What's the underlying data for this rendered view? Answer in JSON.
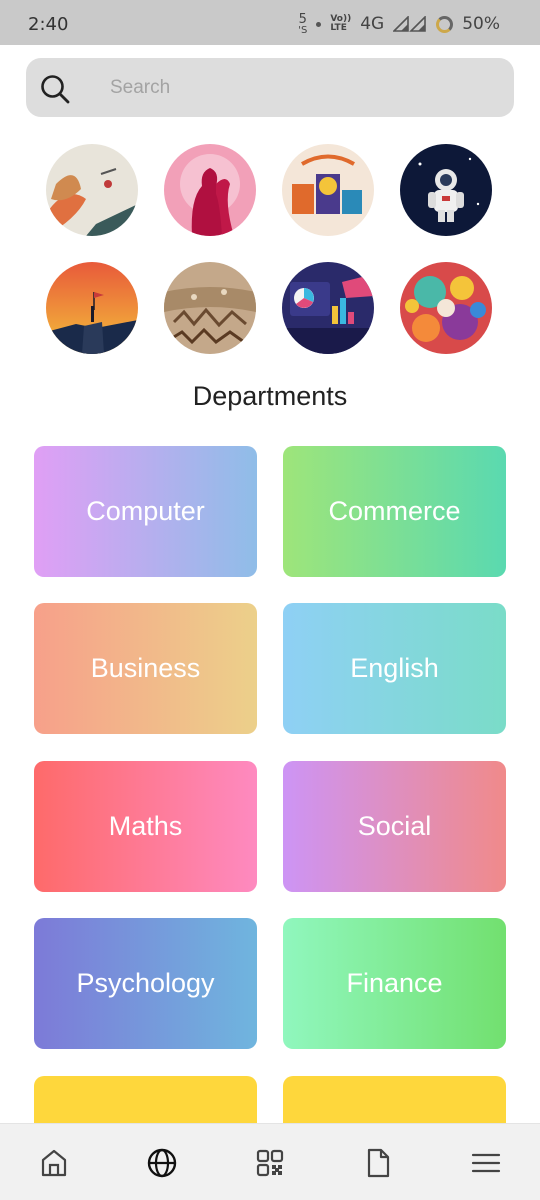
{
  "status_bar": {
    "time": "2:40",
    "notification_digit": "5",
    "notification_sub": "'S",
    "volte_top": "Vo))",
    "volte_bottom": "LTE",
    "network": "4G",
    "battery": "50%"
  },
  "search": {
    "placeholder": "Search"
  },
  "images": [
    {
      "name": "art-thumbnail-1",
      "colors": [
        "#e8e4da",
        "#e07040",
        "#3a5a5a"
      ]
    },
    {
      "name": "art-thumbnail-2",
      "colors": [
        "#f2a0b8",
        "#b01040",
        "#ffffff"
      ]
    },
    {
      "name": "art-thumbnail-3",
      "colors": [
        "#f4e6d8",
        "#e06a2c",
        "#4a3a8c"
      ]
    },
    {
      "name": "art-thumbnail-4",
      "colors": [
        "#0d1838",
        "#ffffff",
        "#c93a3a"
      ]
    },
    {
      "name": "art-thumbnail-5",
      "colors": [
        "#f4a23a",
        "#e85a3a",
        "#1a2a4a"
      ]
    },
    {
      "name": "art-thumbnail-6",
      "colors": [
        "#c4a88a",
        "#6a4a30",
        "#e8d8c0"
      ]
    },
    {
      "name": "art-thumbnail-7",
      "colors": [
        "#2a2a6a",
        "#e04a7a",
        "#3ab8e0"
      ]
    },
    {
      "name": "art-thumbnail-8",
      "colors": [
        "#d84a4a",
        "#4ab8a8",
        "#f4c43a"
      ]
    }
  ],
  "section_title": "Departments",
  "departments": [
    {
      "label": "Computer",
      "colors": [
        "#e09ff5",
        "#8fbde8"
      ]
    },
    {
      "label": "Commerce",
      "colors": [
        "#9ee57a",
        "#5ad9b0"
      ]
    },
    {
      "label": "Business",
      "colors": [
        "#f7a08a",
        "#ecd08a"
      ]
    },
    {
      "label": "English",
      "colors": [
        "#8fd0f5",
        "#7adcc8"
      ]
    },
    {
      "label": "Maths",
      "colors": [
        "#fe6a6a",
        "#fe8ac0"
      ]
    },
    {
      "label": "Social",
      "colors": [
        "#cd94f5",
        "#f08a8a"
      ]
    },
    {
      "label": "Psychology",
      "colors": [
        "#7d7ad8",
        "#6fb5de"
      ]
    },
    {
      "label": "Finance",
      "colors": [
        "#90f7be",
        "#72e06f"
      ]
    },
    {
      "label": "",
      "colors": [
        "#fed73c",
        "#fed73c"
      ]
    },
    {
      "label": "",
      "colors": [
        "#fed73c",
        "#fed73c"
      ]
    }
  ],
  "bottom_nav": [
    {
      "icon": "home-icon"
    },
    {
      "icon": "globe-icon"
    },
    {
      "icon": "qr-code-icon"
    },
    {
      "icon": "document-icon"
    },
    {
      "icon": "menu-icon"
    }
  ]
}
